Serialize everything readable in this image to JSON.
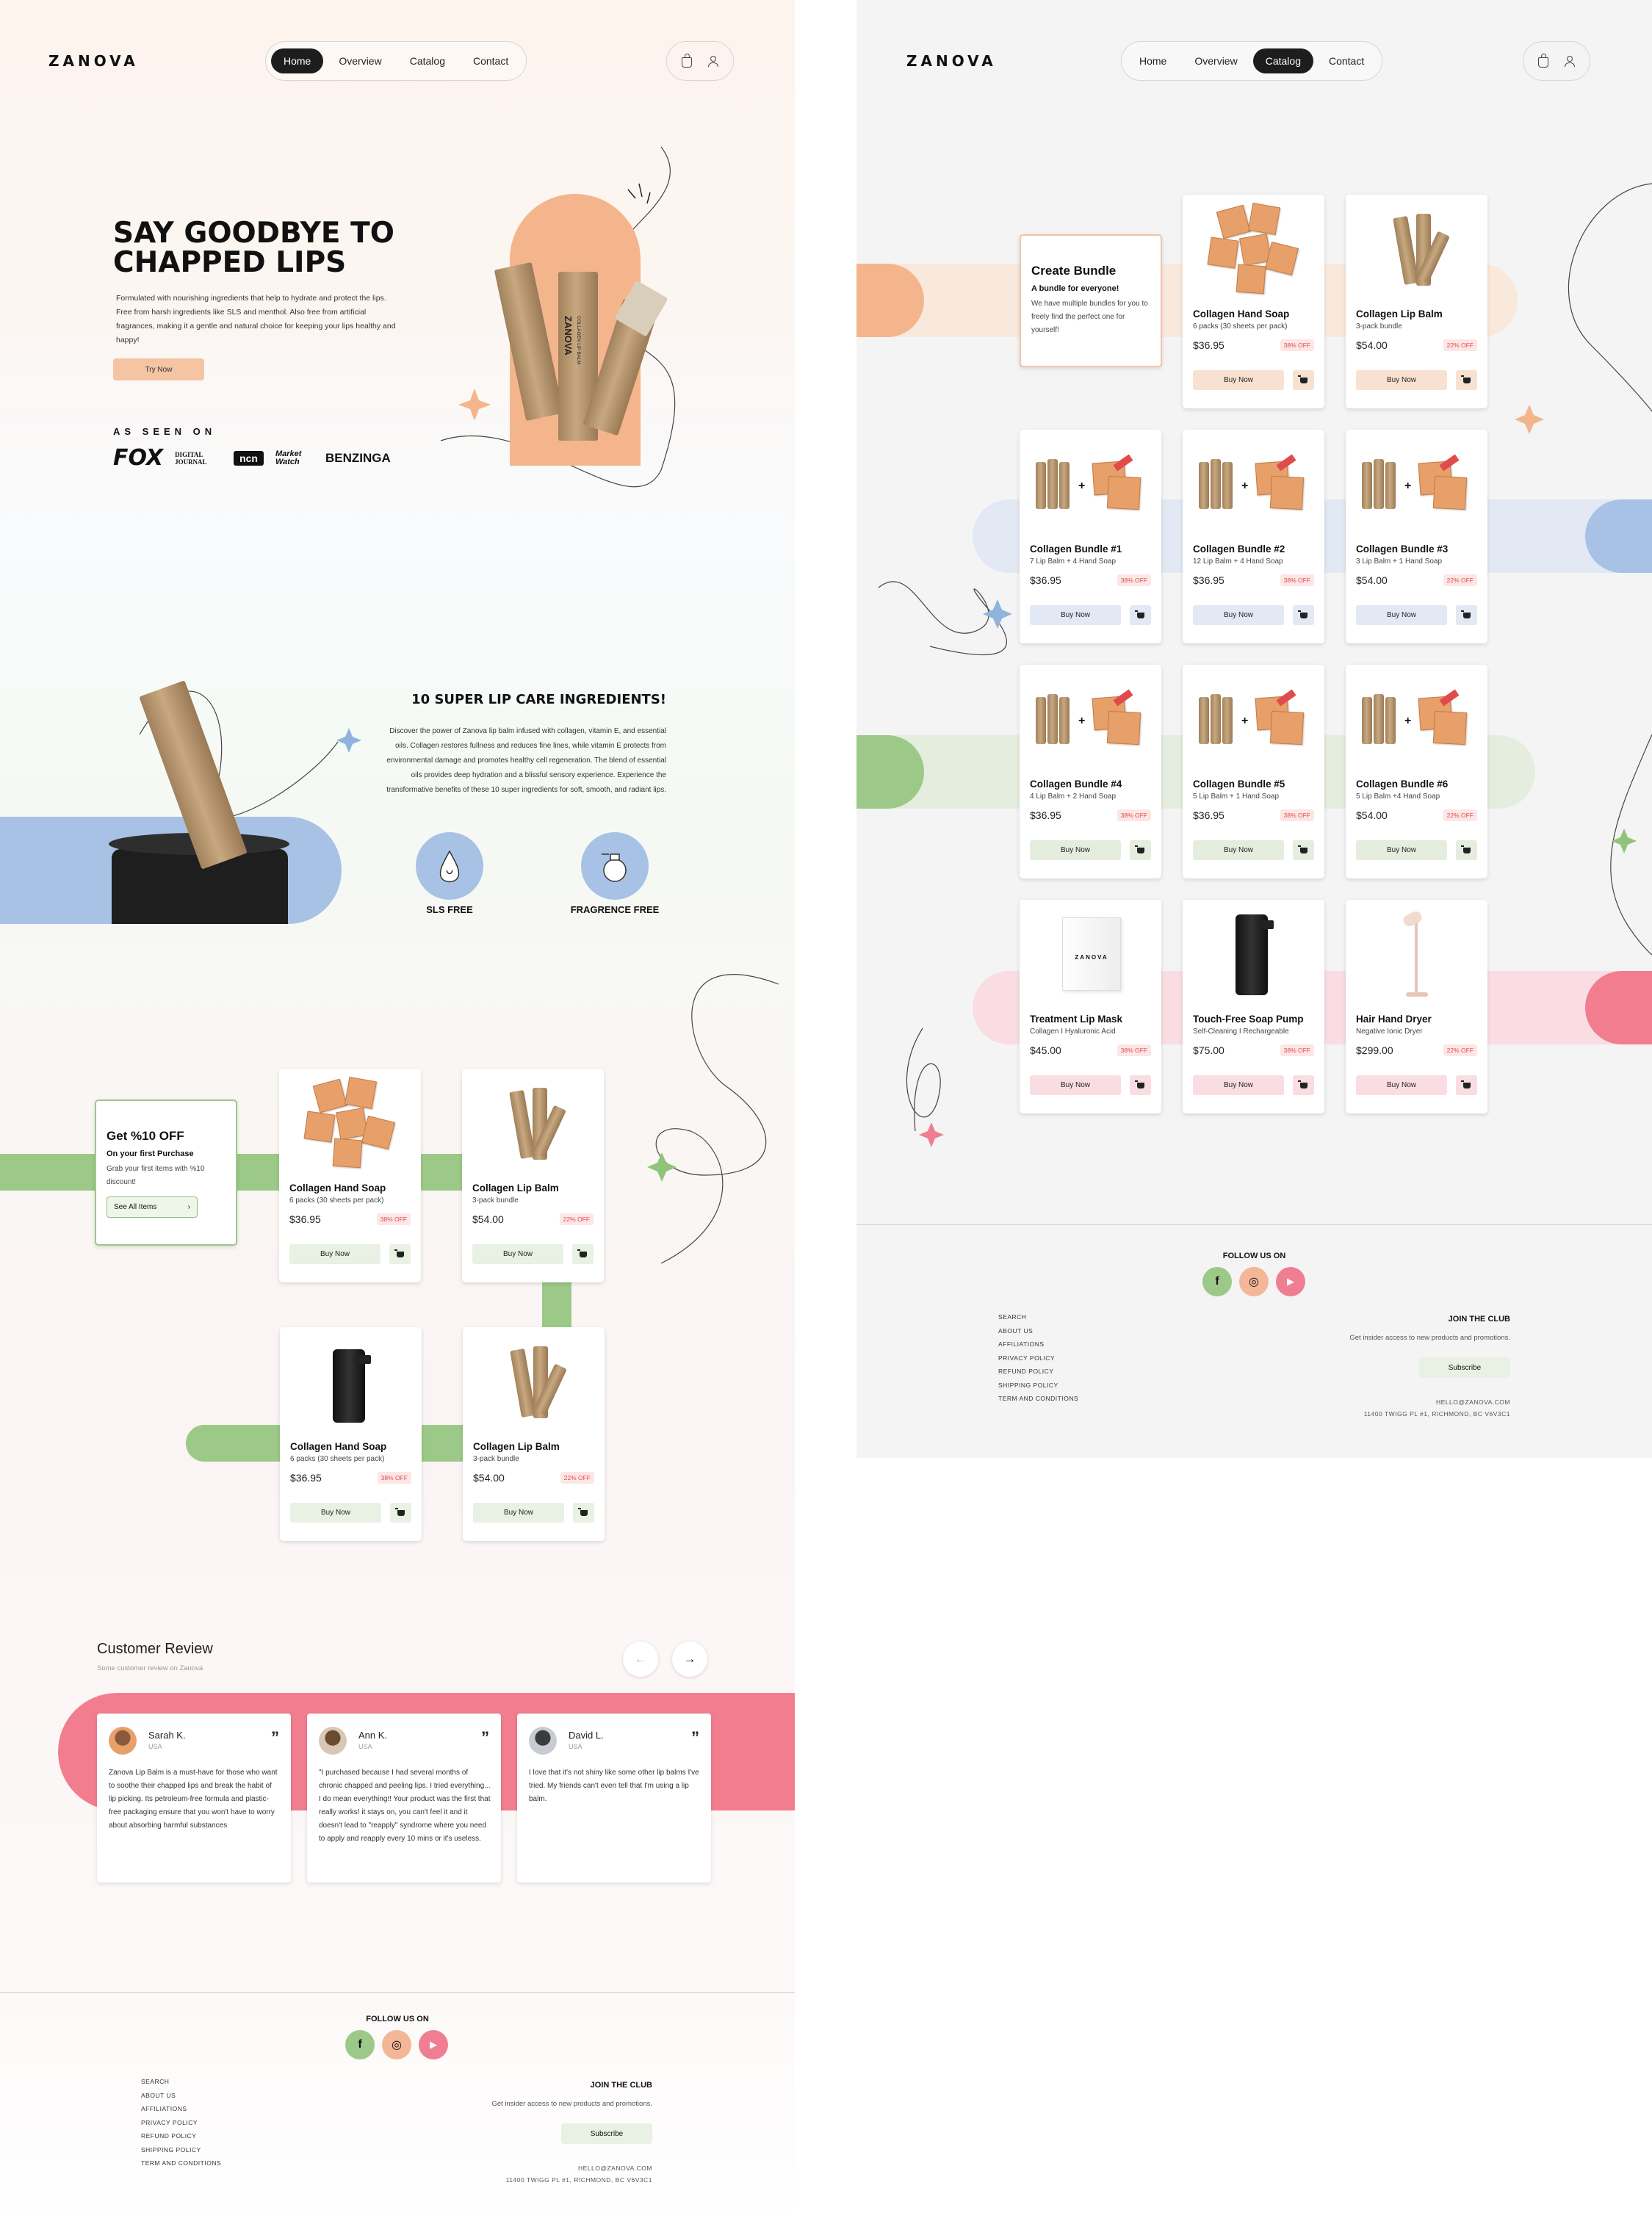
{
  "brand": {
    "logo": "ZANOVA"
  },
  "nav": {
    "items": [
      "Home",
      "Overview",
      "Catalog",
      "Contact"
    ]
  },
  "home": {
    "hero": {
      "title_line1": "SAY GOODBYE TO",
      "title_line2": "CHAPPED LIPS",
      "description": "Formulated with nourishing ingredients that help to hydrate and protect the lips. Free from harsh ingredients like SLS and menthol. Also free from artificial fragrances, making it a gentle and natural choice for keeping your lips healthy and happy!",
      "cta": "Try Now",
      "product_label": "ZANOVA",
      "product_sub": "COLLAGEN LIP BALM"
    },
    "seen_on": {
      "label": "AS SEEN ON",
      "brands": [
        "FOX",
        "DIGITAL JOURNAL",
        "ncn",
        "Market Watch",
        "BENZINGA"
      ]
    },
    "ingredients": {
      "title": "10 SUPER LIP CARE INGREDIENTS!",
      "description": "Discover the power of Zanova lip balm infused with collagen, vitamin E, and essential oils. Collagen restores fullness and reduces fine lines, while vitamin E protects from environmental damage and promotes healthy cell regeneration. The blend of essential oils provides deep hydration and a blissful sensory experience. Experience the transformative benefits of these 10 super ingredients for soft, smooth, and radiant lips.",
      "features": [
        "SLS FREE",
        "FRAGRENCE FREE"
      ]
    },
    "promo": {
      "title": "Get %10 OFF",
      "subtitle": "On your first Purchase",
      "text": "Grab your first items with %10 discount!",
      "button": "See All Items",
      "chevron": "›"
    },
    "products": [
      {
        "name": "Collagen Hand Soap",
        "sub": "6 packs (30 sheets per pack)",
        "price": "$36.95",
        "discount": "38% OFF",
        "buy": "Buy Now"
      },
      {
        "name": "Collagen Lip Balm",
        "sub": "3-pack bundle",
        "price": "$54.00",
        "discount": "22% OFF",
        "buy": "Buy Now"
      },
      {
        "name": "Collagen Hand Soap",
        "sub": "6 packs (30 sheets per pack)",
        "price": "$36.95",
        "discount": "38% OFF",
        "buy": "Buy Now"
      },
      {
        "name": "Collagen Lip Balm",
        "sub": "3-pack bundle",
        "price": "$54.00",
        "discount": "22% OFF",
        "buy": "Buy Now"
      }
    ],
    "reviews_section": {
      "title": "Customer Review",
      "subtitle": "Some customer review on Zanova",
      "prev": "←",
      "next": "→",
      "quote_mark": "”",
      "items": [
        {
          "name": "Sarah K.",
          "country": "USA",
          "text": "Zanova Lip Balm is a must-have for those who want to soothe their chapped lips and break the habit of lip picking. Its petroleum-free formula and plastic-free packaging ensure that you won't have to worry about absorbing harmful substances"
        },
        {
          "name": "Ann K.",
          "country": "USA",
          "text": "\"I purchased because I had several months of chronic chapped and peeling lips. I tried everything... I do mean everything!! Your product was the first that really works! it stays on, you can't feel it and it doesn't lead to \"reapply\" syndrome where you need to apply and reapply every 10 mins or it's useless."
        },
        {
          "name": "David L.",
          "country": "USA",
          "text": "I love that it's not shiny like some other lip balms I've tried. My friends can't even tell that I'm using a lip balm."
        }
      ]
    }
  },
  "catalog": {
    "bundle": {
      "title": "Create Bundle",
      "subtitle": "A bundle for everyone!",
      "text": "We have multiple bundles for you to freely find the perfect one for yourself!"
    },
    "products": [
      {
        "name": "Collagen Hand Soap",
        "sub": "6 packs (30 sheets per pack)",
        "price": "$36.95",
        "discount": "38% OFF",
        "buy": "Buy Now"
      },
      {
        "name": "Collagen Lip Balm",
        "sub": "3-pack bundle",
        "price": "$54.00",
        "discount": "22% OFF",
        "buy": "Buy Now"
      },
      {
        "name": "Collagen Bundle #1",
        "sub": "7 Lip Balm + 4 Hand Soap",
        "price": "$36.95",
        "discount": "38% OFF",
        "buy": "Buy Now"
      },
      {
        "name": "Collagen Bundle #2",
        "sub": "12 Lip Balm + 4 Hand Soap",
        "price": "$36.95",
        "discount": "38% OFF",
        "buy": "Buy Now"
      },
      {
        "name": "Collagen Bundle #3",
        "sub": "3 Lip Balm + 1 Hand Soap",
        "price": "$54.00",
        "discount": "22% OFF",
        "buy": "Buy Now"
      },
      {
        "name": "Collagen Bundle #4",
        "sub": "4 Lip Balm + 2 Hand Soap",
        "price": "$36.95",
        "discount": "38% OFF",
        "buy": "Buy Now"
      },
      {
        "name": "Collagen Bundle #5",
        "sub": "5 Lip Balm + 1 Hand Soap",
        "price": "$36.95",
        "discount": "38% OFF",
        "buy": "Buy Now"
      },
      {
        "name": "Collagen Bundle #6",
        "sub": "5 Lip Balm +4 Hand Soap",
        "price": "$54.00",
        "discount": "22% OFF",
        "buy": "Buy Now"
      },
      {
        "name": "Treatment Lip Mask",
        "sub": "Collagen I Hyaluronic Acid",
        "price": "$45.00",
        "discount": "38% OFF",
        "buy": "Buy Now"
      },
      {
        "name": "Touch-Free Soap Pump",
        "sub": "Self-Cleaning I Rechargeable",
        "price": "$75.00",
        "discount": "38% OFF",
        "buy": "Buy Now"
      },
      {
        "name": "Hair Hand Dryer",
        "sub": "Negative Ionic Dryer",
        "price": "$299.00",
        "discount": "22% OFF",
        "buy": "Buy Now"
      }
    ]
  },
  "footer": {
    "follow": "FOLLOW US ON",
    "social": [
      {
        "icon": "facebook-icon",
        "glyph": "f",
        "color": "#9cc987"
      },
      {
        "icon": "instagram-icon",
        "glyph": "◎",
        "color": "#f3b696"
      },
      {
        "icon": "youtube-icon",
        "glyph": "▶",
        "color": "#ef7e93"
      }
    ],
    "links": [
      "SEARCH",
      "ABOUT US",
      "AFFILIATIONS",
      "PRIVACY POLICY",
      "REFUND POLICY",
      "SHIPPING POLICY",
      "TERM AND CONDITIONS"
    ],
    "club_title": "JOIN THE CLUB",
    "club_text": "Get insider access to new products and promotions.",
    "subscribe": "Subscribe",
    "email": "HELLO@ZANOVA.COM",
    "address": "11400 TWIGG PL #1, RICHMOND, BC V6V3C1"
  },
  "colors": {
    "peach": "#f4c4a3",
    "blue": "#a7c2e4",
    "green": "#9cc987",
    "pink": "#f27d8f",
    "dark": "#1d1d1d"
  }
}
